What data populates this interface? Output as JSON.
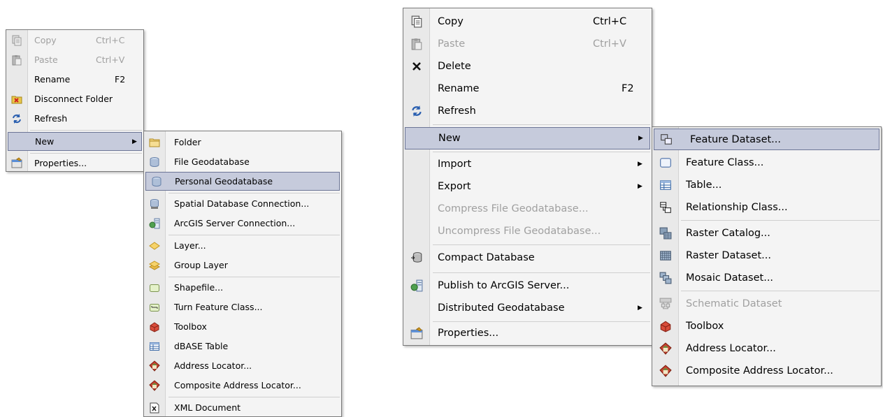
{
  "left_menu": {
    "items": [
      {
        "label": "Copy",
        "shortcut": "Ctrl+C",
        "icon": "copy-icon",
        "disabled": true
      },
      {
        "label": "Paste",
        "shortcut": "Ctrl+V",
        "icon": "paste-icon",
        "disabled": true
      },
      {
        "label": "Rename",
        "shortcut": "F2"
      },
      {
        "label": "Disconnect Folder",
        "icon": "disconnect-folder-icon"
      },
      {
        "label": "Refresh",
        "icon": "refresh-icon"
      },
      {
        "label": "New",
        "submenu": true,
        "highlighted": true
      },
      {
        "label": "Properties...",
        "icon": "properties-icon"
      }
    ]
  },
  "left_submenu": {
    "items": [
      {
        "label": "Folder",
        "icon": "folder-icon"
      },
      {
        "label": "File Geodatabase",
        "icon": "file-geodatabase-icon"
      },
      {
        "label": "Personal Geodatabase",
        "icon": "personal-geodatabase-icon",
        "highlighted": true
      },
      {
        "label": "Spatial Database Connection...",
        "icon": "spatial-database-connection-icon"
      },
      {
        "label": "ArcGIS Server Connection...",
        "icon": "arcgis-server-connection-icon"
      },
      {
        "label": "Layer...",
        "icon": "layer-icon"
      },
      {
        "label": "Group Layer",
        "icon": "group-layer-icon"
      },
      {
        "label": "Shapefile...",
        "icon": "shapefile-icon"
      },
      {
        "label": "Turn Feature Class...",
        "icon": "turn-feature-class-icon"
      },
      {
        "label": "Toolbox",
        "icon": "toolbox-icon"
      },
      {
        "label": "dBASE Table",
        "icon": "dbase-table-icon"
      },
      {
        "label": "Address Locator...",
        "icon": "address-locator-icon"
      },
      {
        "label": "Composite Address Locator...",
        "icon": "composite-address-locator-icon"
      },
      {
        "label": "XML Document",
        "icon": "xml-document-icon"
      }
    ]
  },
  "right_menu": {
    "items": [
      {
        "label": "Copy",
        "shortcut": "Ctrl+C",
        "icon": "copy-icon"
      },
      {
        "label": "Paste",
        "shortcut": "Ctrl+V",
        "icon": "paste-icon",
        "disabled": true
      },
      {
        "label": "Delete",
        "icon": "delete-icon"
      },
      {
        "label": "Rename",
        "shortcut": "F2"
      },
      {
        "label": "Refresh",
        "icon": "refresh-icon"
      },
      {
        "label": "New",
        "submenu": true,
        "highlighted": true
      },
      {
        "label": "Import",
        "submenu": true
      },
      {
        "label": "Export",
        "submenu": true
      },
      {
        "label": "Compress File Geodatabase...",
        "disabled": true
      },
      {
        "label": "Uncompress File Geodatabase...",
        "disabled": true
      },
      {
        "label": "Compact Database",
        "icon": "compact-database-icon"
      },
      {
        "label": "Publish to ArcGIS Server...",
        "icon": "publish-server-icon"
      },
      {
        "label": "Distributed Geodatabase",
        "submenu": true
      },
      {
        "label": "Properties...",
        "icon": "properties-icon"
      }
    ]
  },
  "right_submenu": {
    "items": [
      {
        "label": "Feature Dataset...",
        "icon": "feature-dataset-icon",
        "highlighted": true
      },
      {
        "label": "Feature Class...",
        "icon": "feature-class-icon"
      },
      {
        "label": "Table...",
        "icon": "table-icon"
      },
      {
        "label": "Relationship Class...",
        "icon": "relationship-class-icon"
      },
      {
        "label": "Raster Catalog...",
        "icon": "raster-catalog-icon"
      },
      {
        "label": "Raster Dataset...",
        "icon": "raster-dataset-icon"
      },
      {
        "label": "Mosaic Dataset...",
        "icon": "mosaic-dataset-icon"
      },
      {
        "label": "Schematic Dataset",
        "icon": "schematic-dataset-icon",
        "disabled": true
      },
      {
        "label": "Toolbox",
        "icon": "toolbox-icon"
      },
      {
        "label": "Address Locator...",
        "icon": "address-locator-icon"
      },
      {
        "label": "Composite Address Locator...",
        "icon": "composite-address-locator-icon"
      }
    ]
  },
  "colors": {
    "highlight": "#c6cbdc",
    "highlight_border": "#6c7596",
    "disabled_text": "#a0a0a0",
    "menu_bg": "#f4f4f4",
    "gutter_bg": "#e9e9e9"
  }
}
